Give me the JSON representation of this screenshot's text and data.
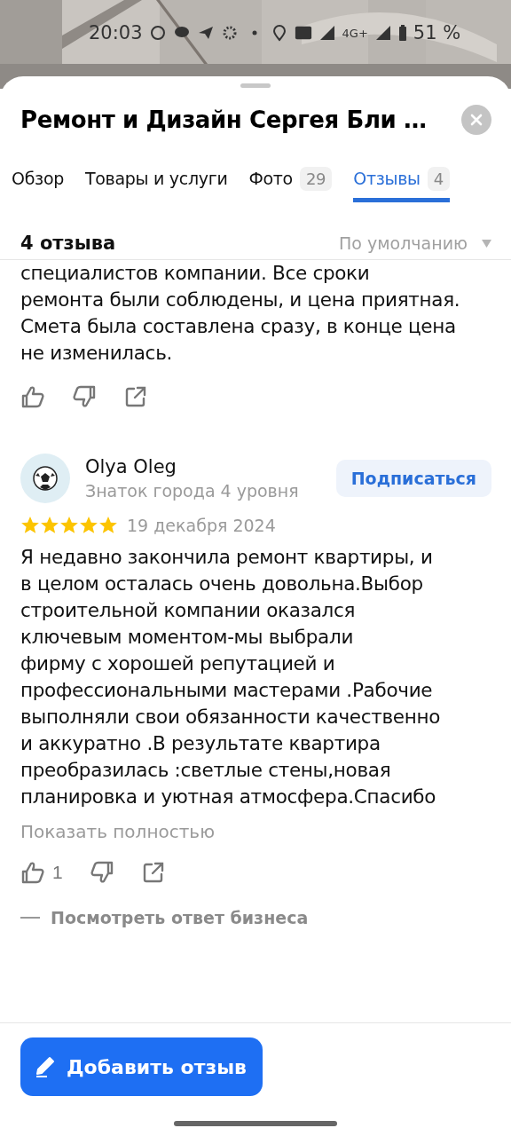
{
  "status_bar": {
    "time": "20:03",
    "network": "4G+",
    "battery": "51 %"
  },
  "sheet": {
    "title": "Ремонт и Дизайн Сергея Бли …"
  },
  "tabs": [
    {
      "label": "Обзор",
      "selected": false
    },
    {
      "label": "Товары и услуги",
      "selected": false
    },
    {
      "label": "Фото",
      "count": "29",
      "selected": false
    },
    {
      "label": "Отзывы",
      "count": "4",
      "selected": true
    }
  ],
  "reviews_header": {
    "count": "4 отзыва",
    "sort": "По умолчанию"
  },
  "reviews": [
    {
      "text_lines": [
        "специалистов компании. Все сроки",
        "ремонта были соблюдены, и цена приятная.",
        "Смета была составлена сразу, в конце цена",
        "не изменилась."
      ]
    },
    {
      "author": "Olya Oleg",
      "level": "Знаток города 4 уровня",
      "subscribe": "Подписаться",
      "stars": 5,
      "date": "19 декабря 2024",
      "text_lines": [
        "Я недавно  закончила ремонт квартиры, и",
        "в целом осталась очень довольна.Выбор",
        "строительной компании оказался",
        "ключевым моментом-мы выбрали",
        "фирму с хорошей репутацией и",
        "профессиональными   мастерами .Рабочие",
        "выполняли свои обязанности качественно",
        "и аккуратно .В результате  квартира",
        "преобразилась :светлые стены,новая",
        "планировка и уютная  атмосфера.Спасибо"
      ],
      "show_more": "Показать полностью",
      "likes": "1",
      "business_reply": "Посмотреть ответ бизнеса"
    }
  ],
  "add_review_button": "Добавить отзыв"
}
